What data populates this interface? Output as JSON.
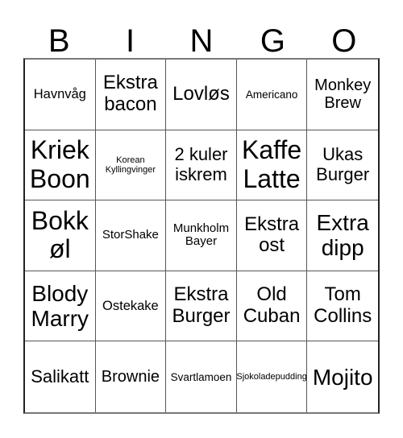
{
  "header": {
    "letters": [
      "B",
      "I",
      "N",
      "G",
      "O"
    ]
  },
  "board": {
    "cells": [
      "Havnvåg",
      "Ekstra\nbacon",
      "Lovløs",
      "Americano",
      "Monkey\nBrew",
      "Kriek\nBoon",
      "Korean\nKyllingvinger",
      "2 kuler\niskrem",
      "Kaffe\nLatte",
      "Ukas\nBurger",
      "Bokk\nøl",
      "StorShake",
      "Munkholm\nBayer",
      "Ekstra\nost",
      "Extra\ndipp",
      "Blody\nMarry",
      "Ostekake",
      "Ekstra\nBurger",
      "Old\nCuban",
      "Tom\nCollins",
      "Salikatt",
      "Brownie",
      "Svartlamoen",
      "Sjokoladepudding",
      "Mojito"
    ]
  }
}
